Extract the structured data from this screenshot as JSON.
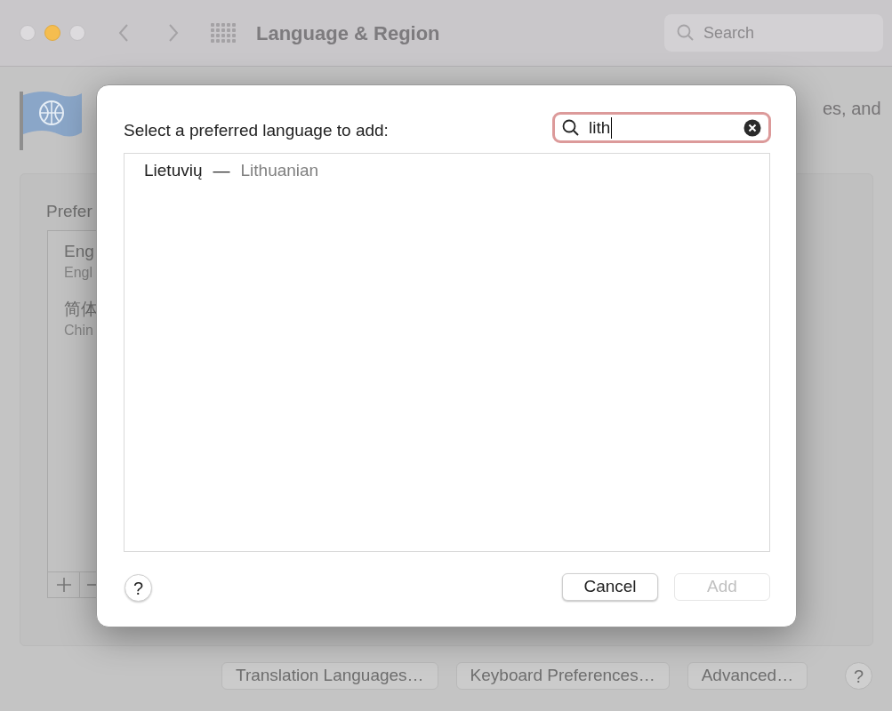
{
  "window": {
    "title": "Language & Region",
    "search_placeholder": "Search"
  },
  "background": {
    "description_fragment": "es, and",
    "preferred_heading": "Prefer",
    "languages": [
      {
        "name": "Eng",
        "subtitle": "Engl"
      },
      {
        "name": "简体",
        "subtitle": "Chin"
      }
    ],
    "buttons": [
      "Translation Languages…",
      "Keyboard Preferences…",
      "Advanced…"
    ],
    "help": "?"
  },
  "dialog": {
    "prompt": "Select a preferred language to add:",
    "search": {
      "value": "lith"
    },
    "results": [
      {
        "native": "Lietuvių",
        "separator": "—",
        "english": "Lithuanian",
        "selected": false
      }
    ],
    "help": "?",
    "buttons": [
      {
        "label": "Cancel",
        "disabled": false
      },
      {
        "label": "Add",
        "disabled": true
      }
    ]
  }
}
